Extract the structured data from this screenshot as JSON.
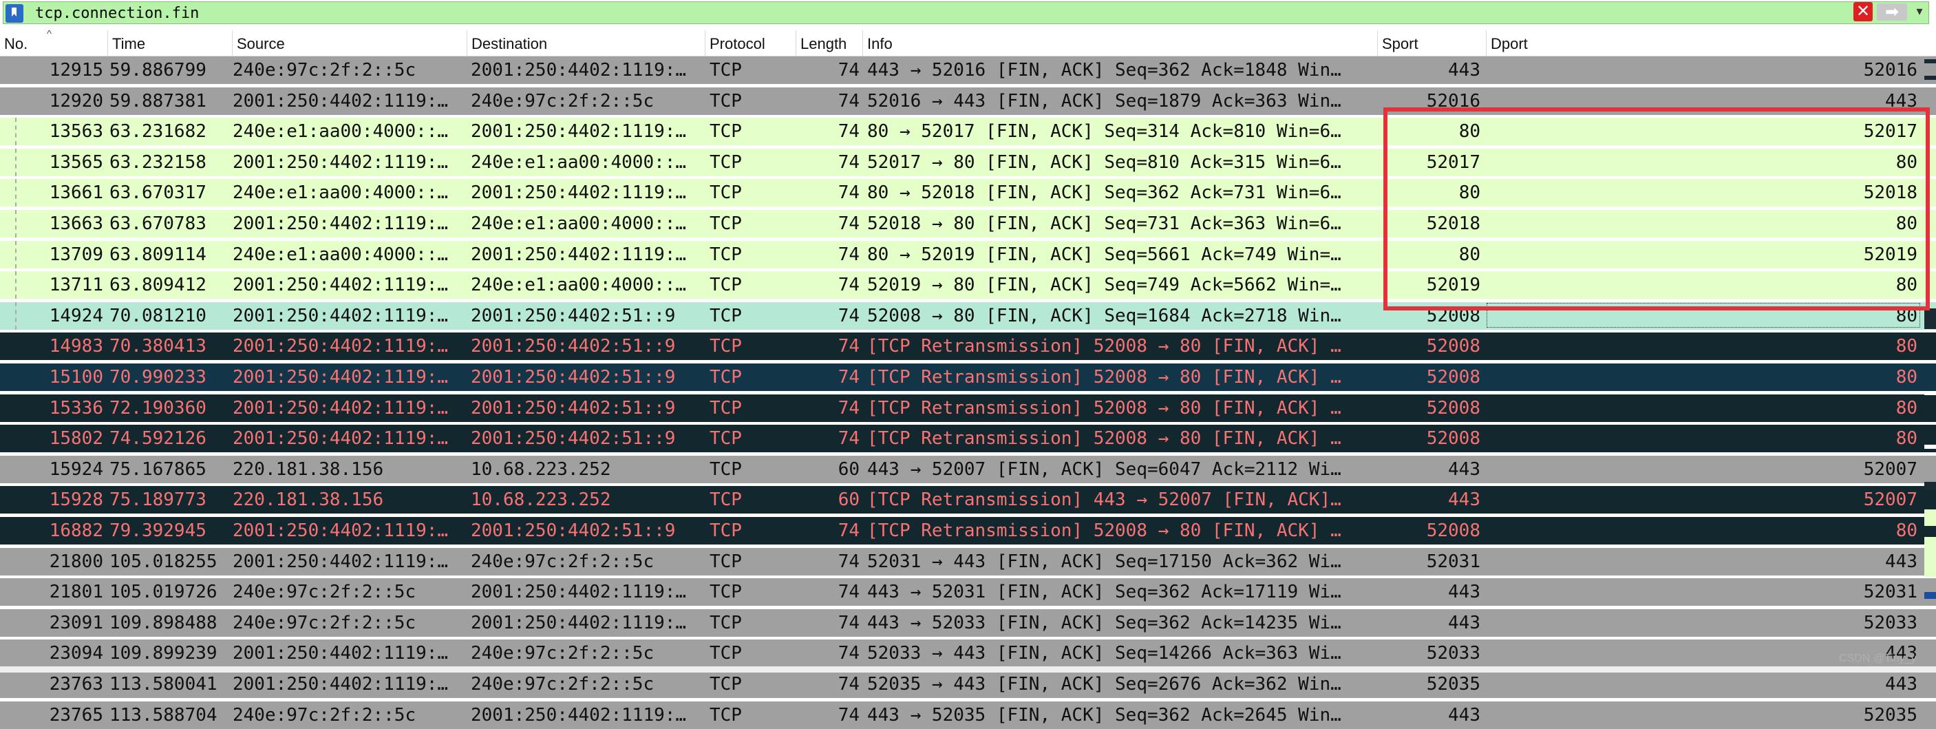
{
  "filter": {
    "value": "tcp.connection.fin"
  },
  "columns": [
    "No.",
    "Time",
    "Source",
    "Destination",
    "Protocol",
    "Length",
    "Info",
    "Sport",
    "Dport"
  ],
  "colors": {
    "gray": "#a0a0a0",
    "green": "#e4ffc7",
    "teal": "#b6e8d6",
    "dark": "#12272e",
    "dark_blue": "#123548",
    "red_text": "#f77272",
    "box": "#e0333a"
  },
  "rows": [
    {
      "no": "12915",
      "time": "59.886799",
      "src": "240e:97c:2f:2::5c",
      "dst": "2001:250:4402:1119:…",
      "proto": "TCP",
      "len": "74",
      "info": "443 → 52016 [FIN, ACK] Seq=362 Ack=1848 Win…",
      "sport": "443",
      "dport": "52016",
      "style": "gray"
    },
    {
      "no": "12920",
      "time": "59.887381",
      "src": "2001:250:4402:1119:…",
      "dst": "240e:97c:2f:2::5c",
      "proto": "TCP",
      "len": "74",
      "info": "52016 → 443 [FIN, ACK] Seq=1879 Ack=363 Win…",
      "sport": "52016",
      "dport": "443",
      "style": "gray"
    },
    {
      "no": "13563",
      "time": "63.231682",
      "src": "240e:e1:aa00:4000::…",
      "dst": "2001:250:4402:1119:…",
      "proto": "TCP",
      "len": "74",
      "info": "80 → 52017 [FIN, ACK] Seq=314 Ack=810 Win=6…",
      "sport": "80",
      "dport": "52017",
      "style": "green"
    },
    {
      "no": "13565",
      "time": "63.232158",
      "src": "2001:250:4402:1119:…",
      "dst": "240e:e1:aa00:4000::…",
      "proto": "TCP",
      "len": "74",
      "info": "52017 → 80 [FIN, ACK] Seq=810 Ack=315 Win=6…",
      "sport": "52017",
      "dport": "80",
      "style": "green"
    },
    {
      "no": "13661",
      "time": "63.670317",
      "src": "240e:e1:aa00:4000::…",
      "dst": "2001:250:4402:1119:…",
      "proto": "TCP",
      "len": "74",
      "info": "80 → 52018 [FIN, ACK] Seq=362 Ack=731 Win=6…",
      "sport": "80",
      "dport": "52018",
      "style": "green"
    },
    {
      "no": "13663",
      "time": "63.670783",
      "src": "2001:250:4402:1119:…",
      "dst": "240e:e1:aa00:4000::…",
      "proto": "TCP",
      "len": "74",
      "info": "52018 → 80 [FIN, ACK] Seq=731 Ack=363 Win=6…",
      "sport": "52018",
      "dport": "80",
      "style": "green"
    },
    {
      "no": "13709",
      "time": "63.809114",
      "src": "240e:e1:aa00:4000::…",
      "dst": "2001:250:4402:1119:…",
      "proto": "TCP",
      "len": "74",
      "info": "80 → 52019 [FIN, ACK] Seq=5661 Ack=749 Win=…",
      "sport": "80",
      "dport": "52019",
      "style": "green"
    },
    {
      "no": "13711",
      "time": "63.809412",
      "src": "2001:250:4402:1119:…",
      "dst": "240e:e1:aa00:4000::…",
      "proto": "TCP",
      "len": "74",
      "info": "52019 → 80 [FIN, ACK] Seq=749 Ack=5662 Win=…",
      "sport": "52019",
      "dport": "80",
      "style": "green"
    },
    {
      "no": "14924",
      "time": "70.081210",
      "src": "2001:250:4402:1119:…",
      "dst": "2001:250:4402:51::9",
      "proto": "TCP",
      "len": "74",
      "info": "52008 → 80 [FIN, ACK] Seq=1684 Ack=2718 Win…",
      "sport": "52008",
      "dport": "80",
      "style": "teal"
    },
    {
      "no": "14983",
      "time": "70.380413",
      "src": "2001:250:4402:1119:…",
      "dst": "2001:250:4402:51::9",
      "proto": "TCP",
      "len": "74",
      "info": "[TCP Retransmission] 52008 → 80 [FIN, ACK] …",
      "sport": "52008",
      "dport": "80",
      "style": "dark"
    },
    {
      "no": "15100",
      "time": "70.990233",
      "src": "2001:250:4402:1119:…",
      "dst": "2001:250:4402:51::9",
      "proto": "TCP",
      "len": "74",
      "info": "[TCP Retransmission] 52008 → 80 [FIN, ACK] …",
      "sport": "52008",
      "dport": "80",
      "style": "dark_blue"
    },
    {
      "no": "15336",
      "time": "72.190360",
      "src": "2001:250:4402:1119:…",
      "dst": "2001:250:4402:51::9",
      "proto": "TCP",
      "len": "74",
      "info": "[TCP Retransmission] 52008 → 80 [FIN, ACK] …",
      "sport": "52008",
      "dport": "80",
      "style": "dark"
    },
    {
      "no": "15802",
      "time": "74.592126",
      "src": "2001:250:4402:1119:…",
      "dst": "2001:250:4402:51::9",
      "proto": "TCP",
      "len": "74",
      "info": "[TCP Retransmission] 52008 → 80 [FIN, ACK] …",
      "sport": "52008",
      "dport": "80",
      "style": "dark"
    },
    {
      "no": "15924",
      "time": "75.167865",
      "src": "220.181.38.156",
      "dst": "10.68.223.252",
      "proto": "TCP",
      "len": "60",
      "info": "443 → 52007 [FIN, ACK] Seq=6047 Ack=2112 Wi…",
      "sport": "443",
      "dport": "52007",
      "style": "gray"
    },
    {
      "no": "15928",
      "time": "75.189773",
      "src": "220.181.38.156",
      "dst": "10.68.223.252",
      "proto": "TCP",
      "len": "60",
      "info": "[TCP Retransmission] 443 → 52007 [FIN, ACK]…",
      "sport": "443",
      "dport": "52007",
      "style": "dark"
    },
    {
      "no": "16882",
      "time": "79.392945",
      "src": "2001:250:4402:1119:…",
      "dst": "2001:250:4402:51::9",
      "proto": "TCP",
      "len": "74",
      "info": "[TCP Retransmission] 52008 → 80 [FIN, ACK] …",
      "sport": "52008",
      "dport": "80",
      "style": "dark"
    },
    {
      "no": "21800",
      "time": "105.018255",
      "src": "2001:250:4402:1119:…",
      "dst": "240e:97c:2f:2::5c",
      "proto": "TCP",
      "len": "74",
      "info": "52031 → 443 [FIN, ACK] Seq=17150 Ack=362 Wi…",
      "sport": "52031",
      "dport": "443",
      "style": "gray"
    },
    {
      "no": "21801",
      "time": "105.019726",
      "src": "240e:97c:2f:2::5c",
      "dst": "2001:250:4402:1119:…",
      "proto": "TCP",
      "len": "74",
      "info": "443 → 52031 [FIN, ACK] Seq=362 Ack=17119 Wi…",
      "sport": "443",
      "dport": "52031",
      "style": "gray"
    },
    {
      "no": "23091",
      "time": "109.898488",
      "src": "240e:97c:2f:2::5c",
      "dst": "2001:250:4402:1119:…",
      "proto": "TCP",
      "len": "74",
      "info": "443 → 52033 [FIN, ACK] Seq=362 Ack=14235 Wi…",
      "sport": "443",
      "dport": "52033",
      "style": "gray"
    },
    {
      "no": "23094",
      "time": "109.899239",
      "src": "2001:250:4402:1119:…",
      "dst": "240e:97c:2f:2::5c",
      "proto": "TCP",
      "len": "74",
      "info": "52033 → 443 [FIN, ACK] Seq=14266 Ack=363 Wi…",
      "sport": "52033",
      "dport": "443",
      "style": "gray"
    },
    {
      "no": "23763",
      "time": "113.580041",
      "src": "2001:250:4402:1119:…",
      "dst": "240e:97c:2f:2::5c",
      "proto": "TCP",
      "len": "74",
      "info": "52035 → 443 [FIN, ACK] Seq=2676 Ack=362 Win…",
      "sport": "52035",
      "dport": "443",
      "style": "gray"
    },
    {
      "no": "23765",
      "time": "113.588704",
      "src": "240e:97c:2f:2::5c",
      "dst": "2001:250:4402:1119:…",
      "proto": "TCP",
      "len": "74",
      "info": "443 → 52035 [FIN, ACK] Seq=362 Ack=2645 Win…",
      "sport": "443",
      "dport": "52035",
      "style": "gray"
    }
  ],
  "watermark": "CSDN @Tiny_y"
}
